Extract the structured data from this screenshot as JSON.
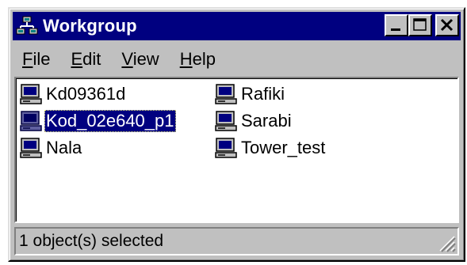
{
  "window": {
    "title": "Workgroup"
  },
  "menu": {
    "file": {
      "label": "File",
      "accel": "F",
      "rest": "ile"
    },
    "edit": {
      "label": "Edit",
      "accel": "E",
      "rest": "dit"
    },
    "view": {
      "label": "View",
      "accel": "V",
      "rest": "iew"
    },
    "help": {
      "label": "Help",
      "accel": "H",
      "rest": "elp"
    }
  },
  "items": [
    {
      "label": "Kd09361d",
      "selected": false
    },
    {
      "label": "Kod_02e640_p1",
      "selected": true
    },
    {
      "label": "Nala",
      "selected": false
    },
    {
      "label": "Rafiki",
      "selected": false
    },
    {
      "label": "Sarabi",
      "selected": false
    },
    {
      "label": "Tower_test",
      "selected": false
    }
  ],
  "status": {
    "text": "1 object(s) selected"
  },
  "icons": {
    "app": "network-workgroup-icon",
    "item": "computer-icon",
    "minimize": "minimize-icon",
    "maximize": "maximize-icon",
    "close": "close-icon",
    "grip": "size-grip-icon"
  },
  "colors": {
    "title_bar": "#000080",
    "face": "#c0c0c0",
    "selection": "#000080"
  }
}
